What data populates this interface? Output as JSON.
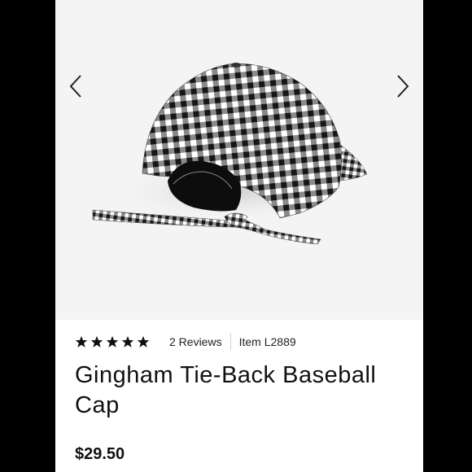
{
  "product": {
    "title": "Gingham Tie-Back Baseball Cap",
    "price": "$29.50",
    "rating_stars": 5,
    "reviews_label": "2 Reviews",
    "item_label": "Item L2889"
  },
  "icons": {
    "prev": "chevron-left-icon",
    "next": "chevron-right-icon",
    "star": "star-icon"
  },
  "colors": {
    "page_bg": "#000000",
    "image_bg": "#f4f4f4",
    "gingham_dark": "#1c1c1c",
    "text": "#111111"
  }
}
